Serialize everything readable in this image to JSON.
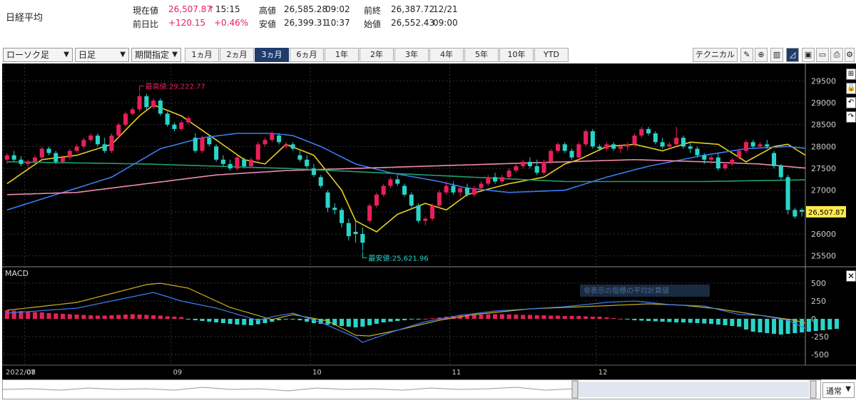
{
  "header": {
    "title": "日経平均",
    "current_label": "現在値",
    "current_value": "26,507.87",
    "current_arrow": "↑",
    "current_time": "15:15",
    "change_label": "前日比",
    "change_value": "+120.15",
    "change_pct": "+0.46%",
    "high_label": "高値",
    "high_value": "26,585.28",
    "high_time": "09:02",
    "low_label": "安値",
    "low_value": "26,399.31",
    "low_time": "10:37",
    "prev_label": "前終",
    "prev_value": "26,387.72",
    "prev_date": "12/21",
    "open_label": "始値",
    "open_value": "26,552.43",
    "open_time": "09:00"
  },
  "toolbar": {
    "chart_type": "ローソク足",
    "interval": "日足",
    "period_mode": "期間指定",
    "periods": [
      "1ヵ月",
      "2ヵ月",
      "3ヵ月",
      "6ヵ月",
      "1年",
      "2年",
      "3年",
      "4年",
      "5年",
      "10年",
      "YTD"
    ],
    "active_period": "3ヵ月",
    "technical_label": "テクニカル"
  },
  "footer": {
    "mode": "通常"
  },
  "colors": {
    "up": "#e8205a",
    "down": "#2ad4c8",
    "ma5": "#e8d020",
    "ma25": "#3a7cf0",
    "ma75": "#f08ab0",
    "ma200": "#20a070",
    "macd": "#3a7cf0",
    "signal": "#c8b020"
  },
  "chart_data": {
    "type": "candlestick",
    "ylim": [
      25300,
      29800
    ],
    "yticks": [
      25500,
      26000,
      26500,
      27000,
      27500,
      28000,
      28500,
      29000,
      29500
    ],
    "last_price_label": "26,507.87",
    "last_price": 26507.87,
    "high_annotation": "最高値:29,222.77",
    "low_annotation": "最安値:25,621.96",
    "x_labels": [
      "2022/07",
      "08",
      "09",
      "10",
      "11",
      "12"
    ],
    "x_label_index": [
      0,
      3,
      24,
      44,
      64,
      85
    ],
    "candles": [
      [
        27700,
        27850,
        27600,
        27800
      ],
      [
        27800,
        27900,
        27650,
        27700
      ],
      [
        27700,
        27780,
        27550,
        27600
      ],
      [
        27600,
        27700,
        27500,
        27650
      ],
      [
        27650,
        27800,
        27600,
        27750
      ],
      [
        27750,
        28000,
        27700,
        27950
      ],
      [
        27950,
        28000,
        27800,
        27850
      ],
      [
        27850,
        27900,
        27600,
        27650
      ],
      [
        27650,
        27800,
        27600,
        27750
      ],
      [
        27750,
        27950,
        27700,
        27900
      ],
      [
        27900,
        28050,
        27850,
        28000
      ],
      [
        28000,
        28200,
        27950,
        28150
      ],
      [
        28150,
        28300,
        28100,
        28250
      ],
      [
        28250,
        28300,
        28000,
        28050
      ],
      [
        28050,
        28200,
        27850,
        27900
      ],
      [
        27900,
        28300,
        27850,
        28250
      ],
      [
        28250,
        28550,
        28200,
        28500
      ],
      [
        28500,
        28800,
        28450,
        28750
      ],
      [
        28750,
        28900,
        28700,
        28850
      ],
      [
        28850,
        29222,
        28800,
        29150
      ],
      [
        29150,
        29200,
        28850,
        28900
      ],
      [
        28900,
        29100,
        28850,
        29050
      ],
      [
        29050,
        29100,
        28700,
        28750
      ],
      [
        28750,
        28800,
        28450,
        28500
      ],
      [
        28500,
        28550,
        28350,
        28400
      ],
      [
        28400,
        28600,
        28350,
        28550
      ],
      [
        28550,
        28700,
        28500,
        28650
      ],
      [
        28200,
        28300,
        27850,
        27900
      ],
      [
        27900,
        28250,
        27850,
        28200
      ],
      [
        28200,
        28250,
        28000,
        28050
      ],
      [
        28000,
        28050,
        27650,
        27700
      ],
      [
        27700,
        27800,
        27550,
        27600
      ],
      [
        27600,
        27700,
        27450,
        27500
      ],
      [
        27500,
        27800,
        27450,
        27750
      ],
      [
        27700,
        27750,
        27500,
        27550
      ],
      [
        27550,
        27750,
        27500,
        27700
      ],
      [
        27700,
        28100,
        27650,
        28050
      ],
      [
        28050,
        28200,
        28000,
        28150
      ],
      [
        28150,
        28350,
        28100,
        28300
      ],
      [
        28250,
        28300,
        28050,
        28100
      ],
      [
        28000,
        28100,
        27950,
        28050
      ],
      [
        28050,
        28100,
        27900,
        27950
      ],
      [
        27800,
        27900,
        27650,
        27700
      ],
      [
        27700,
        27800,
        27500,
        27550
      ],
      [
        27500,
        27600,
        27300,
        27350
      ],
      [
        27300,
        27350,
        27050,
        27100
      ],
      [
        26950,
        27000,
        26500,
        26600
      ],
      [
        26600,
        26700,
        26450,
        26550
      ],
      [
        26550,
        26600,
        26150,
        26250
      ],
      [
        26250,
        26350,
        25850,
        25950
      ],
      [
        26050,
        26300,
        25800,
        26000
      ],
      [
        26000,
        26150,
        25621,
        25800
      ],
      [
        26300,
        26700,
        26250,
        26650
      ],
      [
        26650,
        26950,
        26600,
        26900
      ],
      [
        26900,
        27150,
        26850,
        27100
      ],
      [
        27100,
        27300,
        27050,
        27250
      ],
      [
        27250,
        27350,
        27100,
        27150
      ],
      [
        27100,
        27150,
        26850,
        26900
      ],
      [
        26900,
        26950,
        26600,
        26650
      ],
      [
        26650,
        26700,
        26250,
        26300
      ],
      [
        26300,
        26400,
        26200,
        26350
      ],
      [
        26350,
        26700,
        26300,
        26650
      ],
      [
        26650,
        27000,
        26600,
        26950
      ],
      [
        26950,
        27200,
        26900,
        27100
      ],
      [
        27100,
        27200,
        26900,
        26950
      ],
      [
        26950,
        27100,
        26850,
        27050
      ],
      [
        27050,
        27150,
        26850,
        26900
      ],
      [
        26900,
        27100,
        26850,
        27050
      ],
      [
        27050,
        27200,
        27000,
        27150
      ],
      [
        27150,
        27350,
        27100,
        27300
      ],
      [
        27300,
        27400,
        27150,
        27200
      ],
      [
        27200,
        27350,
        27150,
        27300
      ],
      [
        27300,
        27500,
        27250,
        27450
      ],
      [
        27450,
        27600,
        27400,
        27550
      ],
      [
        27550,
        27700,
        27500,
        27650
      ],
      [
        27650,
        27750,
        27500,
        27550
      ],
      [
        27550,
        27700,
        27350,
        27400
      ],
      [
        27400,
        27700,
        27350,
        27650
      ],
      [
        27650,
        27950,
        27600,
        27900
      ],
      [
        27900,
        28100,
        27850,
        28050
      ],
      [
        28050,
        28100,
        27850,
        27900
      ],
      [
        27900,
        27950,
        27700,
        27750
      ],
      [
        27750,
        28100,
        27700,
        28050
      ],
      [
        28050,
        28400,
        28000,
        28350
      ],
      [
        28350,
        28400,
        27950,
        28000
      ],
      [
        28000,
        28050,
        27900,
        27950
      ],
      [
        27950,
        28100,
        27900,
        28050
      ],
      [
        28050,
        28100,
        27900,
        27950
      ],
      [
        27950,
        28050,
        27850,
        28000
      ],
      [
        28000,
        28100,
        27900,
        28050
      ],
      [
        28050,
        28300,
        28000,
        28250
      ],
      [
        28250,
        28450,
        28200,
        28400
      ],
      [
        28400,
        28450,
        28250,
        28300
      ],
      [
        28300,
        28350,
        28050,
        28100
      ],
      [
        28100,
        28200,
        27950,
        28000
      ],
      [
        28000,
        28100,
        27950,
        28050
      ],
      [
        28050,
        28450,
        28000,
        28200
      ],
      [
        28200,
        28250,
        27950,
        28000
      ],
      [
        28000,
        28100,
        27850,
        27950
      ],
      [
        27950,
        28000,
        27750,
        27800
      ],
      [
        27800,
        27850,
        27600,
        27700
      ],
      [
        27700,
        27800,
        27600,
        27750
      ],
      [
        27750,
        27850,
        27450,
        27500
      ],
      [
        27500,
        27650,
        27450,
        27600
      ],
      [
        27600,
        27750,
        27550,
        27700
      ],
      [
        27750,
        27950,
        27700,
        27900
      ],
      [
        27900,
        28150,
        27850,
        28100
      ],
      [
        28100,
        28150,
        27950,
        28000
      ],
      [
        28000,
        28100,
        27950,
        28050
      ],
      [
        28050,
        28150,
        27950,
        28000
      ],
      [
        27850,
        27900,
        27500,
        27550
      ],
      [
        27550,
        27600,
        27250,
        27300
      ],
      [
        27300,
        27350,
        26450,
        26550
      ],
      [
        26550,
        26600,
        26350,
        26400
      ],
      [
        26552,
        26585,
        26399,
        26508
      ]
    ],
    "ma_lines": [
      {
        "name": "MA5",
        "color": "#e8d020",
        "anchors": [
          [
            0,
            27150
          ],
          [
            5,
            27700
          ],
          [
            10,
            27800
          ],
          [
            15,
            28050
          ],
          [
            19,
            28700
          ],
          [
            21,
            28950
          ],
          [
            25,
            28700
          ],
          [
            30,
            28150
          ],
          [
            34,
            27700
          ],
          [
            37,
            27600
          ],
          [
            40,
            28050
          ],
          [
            44,
            27800
          ],
          [
            48,
            27000
          ],
          [
            50,
            26300
          ],
          [
            53,
            26050
          ],
          [
            56,
            26450
          ],
          [
            60,
            26700
          ],
          [
            63,
            26550
          ],
          [
            66,
            26900
          ],
          [
            72,
            27150
          ],
          [
            77,
            27300
          ],
          [
            80,
            27600
          ],
          [
            82,
            27700
          ],
          [
            86,
            28000
          ],
          [
            90,
            28050
          ],
          [
            94,
            27900
          ],
          [
            98,
            28100
          ],
          [
            102,
            28050
          ],
          [
            106,
            27650
          ],
          [
            110,
            28000
          ],
          [
            112,
            28050
          ],
          [
            116,
            27650
          ],
          [
            119,
            26900
          ]
        ]
      },
      {
        "name": "MA25",
        "color": "#3a7cf0",
        "anchors": [
          [
            0,
            26550
          ],
          [
            8,
            26950
          ],
          [
            15,
            27300
          ],
          [
            22,
            27950
          ],
          [
            28,
            28200
          ],
          [
            33,
            28300
          ],
          [
            38,
            28300
          ],
          [
            41,
            28250
          ],
          [
            45,
            28000
          ],
          [
            50,
            27600
          ],
          [
            55,
            27400
          ],
          [
            62,
            27200
          ],
          [
            66,
            27050
          ],
          [
            72,
            26950
          ],
          [
            80,
            27000
          ],
          [
            86,
            27300
          ],
          [
            92,
            27550
          ],
          [
            100,
            27800
          ],
          [
            106,
            27950
          ],
          [
            112,
            28000
          ],
          [
            115,
            27950
          ],
          [
            119,
            27750
          ]
        ]
      },
      {
        "name": "MA75",
        "color": "#f08ab0",
        "anchors": [
          [
            0,
            26900
          ],
          [
            10,
            26950
          ],
          [
            20,
            27150
          ],
          [
            30,
            27350
          ],
          [
            40,
            27450
          ],
          [
            50,
            27500
          ],
          [
            60,
            27550
          ],
          [
            70,
            27600
          ],
          [
            80,
            27650
          ],
          [
            90,
            27700
          ],
          [
            100,
            27650
          ],
          [
            108,
            27600
          ],
          [
            115,
            27500
          ],
          [
            119,
            27450
          ]
        ]
      },
      {
        "name": "MA200",
        "color": "#20a070",
        "anchors": [
          [
            0,
            27650
          ],
          [
            20,
            27600
          ],
          [
            40,
            27500
          ],
          [
            60,
            27350
          ],
          [
            80,
            27200
          ],
          [
            100,
            27200
          ],
          [
            119,
            27250
          ]
        ]
      }
    ],
    "macd": {
      "ylim": [
        -620,
        620
      ],
      "yticks": [
        500,
        250,
        0,
        -250,
        -500
      ],
      "label": "MACD",
      "overlay_text": "非表示の指標の平均計算値",
      "hist": [
        120,
        115,
        110,
        100,
        95,
        90,
        80,
        75,
        70,
        65,
        60,
        55,
        50,
        45,
        45,
        50,
        55,
        60,
        65,
        60,
        55,
        50,
        45,
        35,
        30,
        25,
        -10,
        -20,
        -30,
        -40,
        -50,
        -60,
        -70,
        -80,
        -85,
        -90,
        -75,
        -60,
        -40,
        -20,
        -10,
        -5,
        -20,
        -40,
        -60,
        -70,
        -80,
        -90,
        -100,
        -110,
        -120,
        -110,
        -90,
        -70,
        -50,
        -40,
        -30,
        -20,
        -10,
        -5,
        0,
        10,
        20,
        30,
        40,
        50,
        55,
        60,
        60,
        65,
        65,
        65,
        60,
        60,
        55,
        55,
        50,
        50,
        45,
        45,
        40,
        40,
        40,
        35,
        30,
        30,
        20,
        10,
        0,
        -10,
        -20,
        -25,
        -30,
        -35,
        -40,
        -45,
        -50,
        -50,
        -55,
        -60,
        -65,
        -70,
        -80,
        -90,
        -100,
        -110,
        -150,
        -180,
        -190,
        -200,
        -210,
        -220,
        -210,
        -200,
        -190,
        -180,
        -170,
        -160,
        -150,
        -140
      ],
      "macd_anchors": [
        [
          0,
          80
        ],
        [
          10,
          150
        ],
        [
          19,
          330
        ],
        [
          21,
          370
        ],
        [
          25,
          250
        ],
        [
          30,
          150
        ],
        [
          36,
          -20
        ],
        [
          38,
          30
        ],
        [
          41,
          80
        ],
        [
          45,
          -50
        ],
        [
          50,
          -260
        ],
        [
          51,
          -330
        ],
        [
          55,
          -190
        ],
        [
          60,
          -40
        ],
        [
          65,
          50
        ],
        [
          70,
          110
        ],
        [
          80,
          170
        ],
        [
          86,
          230
        ],
        [
          90,
          250
        ],
        [
          95,
          200
        ],
        [
          100,
          180
        ],
        [
          105,
          60
        ],
        [
          108,
          50
        ],
        [
          112,
          -20
        ],
        [
          116,
          -200
        ],
        [
          119,
          -140
        ]
      ],
      "signal_anchors": [
        [
          0,
          120
        ],
        [
          10,
          230
        ],
        [
          20,
          480
        ],
        [
          22,
          500
        ],
        [
          26,
          430
        ],
        [
          32,
          160
        ],
        [
          38,
          -10
        ],
        [
          41,
          60
        ],
        [
          46,
          -30
        ],
        [
          50,
          -230
        ],
        [
          52,
          -240
        ],
        [
          56,
          -160
        ],
        [
          62,
          -20
        ],
        [
          67,
          60
        ],
        [
          75,
          140
        ],
        [
          85,
          180
        ],
        [
          92,
          210
        ],
        [
          97,
          190
        ],
        [
          102,
          140
        ],
        [
          108,
          50
        ],
        [
          113,
          -20
        ],
        [
          117,
          -130
        ],
        [
          119,
          -160
        ]
      ]
    }
  }
}
